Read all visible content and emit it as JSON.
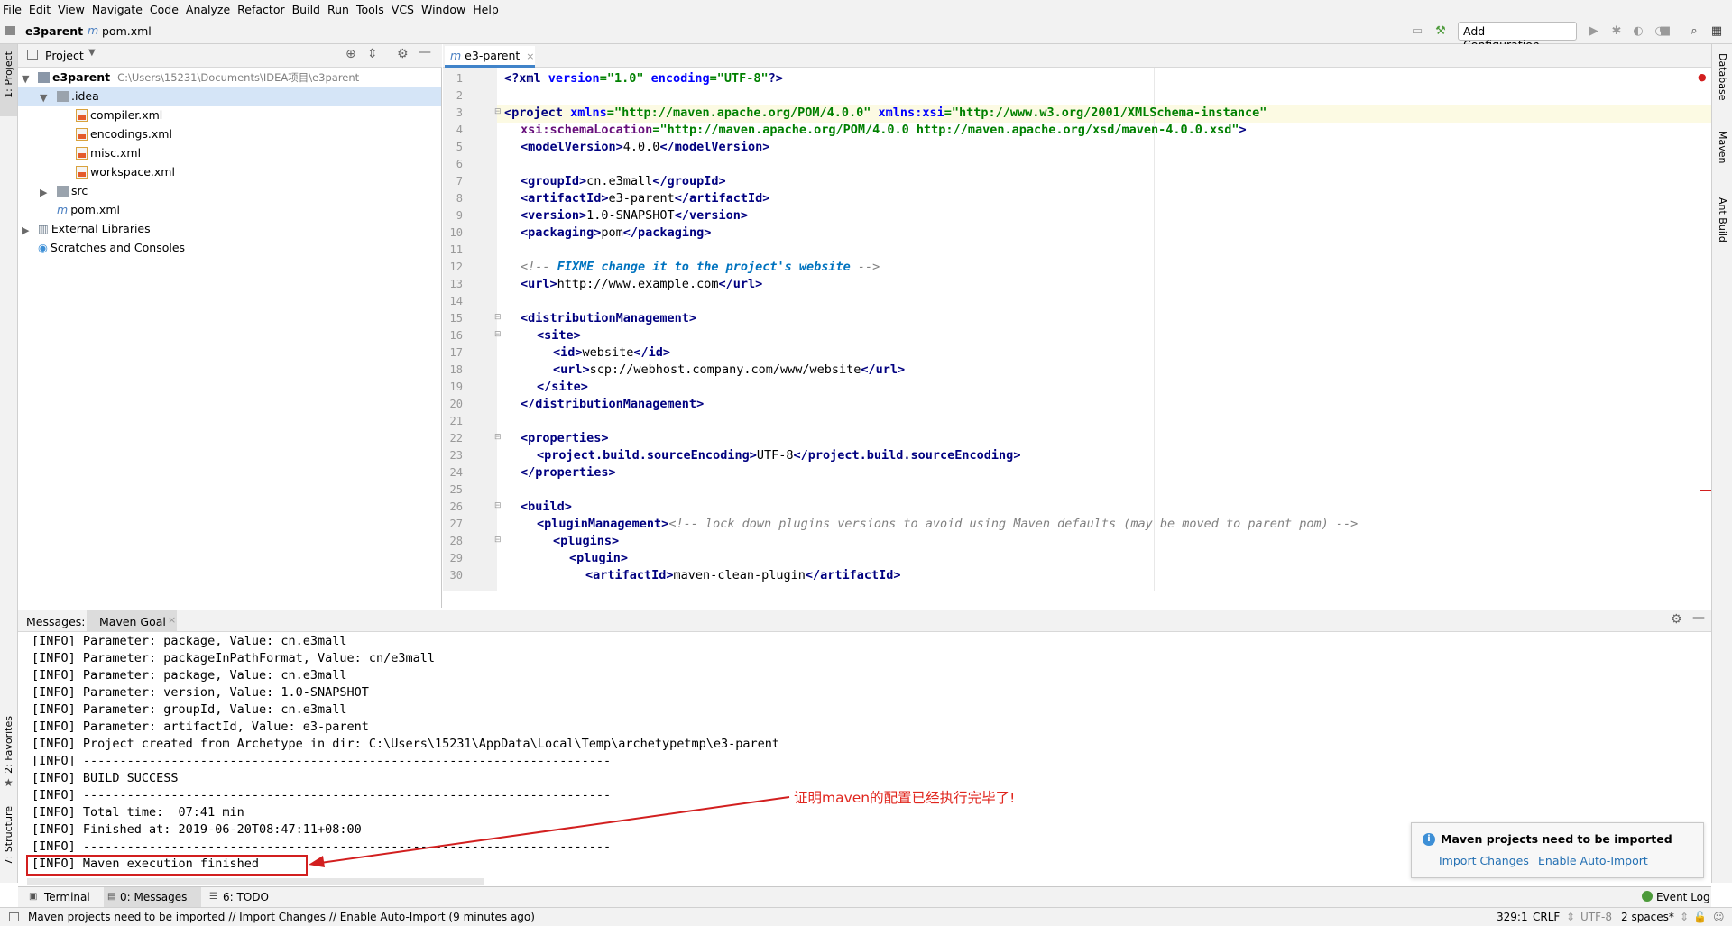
{
  "menu": [
    "File",
    "Edit",
    "View",
    "Navigate",
    "Code",
    "Analyze",
    "Refactor",
    "Build",
    "Run",
    "Tools",
    "VCS",
    "Window",
    "Help"
  ],
  "nav": {
    "project": "e3parent",
    "file": "pom.xml",
    "add_configuration": "Add Configuration..."
  },
  "left_stripe": {
    "project": "1: Project",
    "favorites": "2: Favorites",
    "structure": "7: Structure"
  },
  "right_stripe": {
    "database": "Database",
    "maven": "Maven",
    "ant": "Ant Build"
  },
  "project_panel": {
    "title": "Project",
    "root_name": "e3parent",
    "root_path": "C:\\Users\\15231\\Documents\\IDEA项目\\e3parent",
    "idea_folder": ".idea",
    "idea_files": [
      "compiler.xml",
      "encodings.xml",
      "misc.xml",
      "workspace.xml"
    ],
    "src": "src",
    "pom": "pom.xml",
    "external": "External Libraries",
    "scratches": "Scratches and Consoles"
  },
  "editor": {
    "tab": "e3-parent",
    "line_numbers": [
      "1",
      "2",
      "3",
      "4",
      "5",
      "6",
      "7",
      "8",
      "9",
      "10",
      "11",
      "12",
      "13",
      "14",
      "15",
      "16",
      "17",
      "18",
      "19",
      "20",
      "21",
      "22",
      "23",
      "24",
      "25",
      "26",
      "27",
      "28",
      "29",
      "30"
    ],
    "l1a": "<?xml ",
    "l1b": "version",
    "l1c": "=",
    "l1d": "\"1.0\"",
    "l1e": " encoding",
    "l1f": "=",
    "l1g": "\"UTF-8\"",
    "l1h": "?>",
    "l3a": "<project ",
    "l3b": "xmlns",
    "l3c": "=",
    "l3d": "\"http://maven.apache.org/POM/4.0.0\"",
    "l3e": " xmlns:xsi",
    "l3f": "=",
    "l3g": "\"http://www.w3.org/2001/XMLSchema-instance\"",
    "l4a": "xsi:schemaLocation",
    "l4b": "=",
    "l4c": "\"http://maven.apache.org/POM/4.0.0 http://maven.apache.org/xsd/maven-4.0.0.xsd\"",
    "l4d": ">",
    "l5a": "<modelVersion>",
    "l5b": "4.0.0",
    "l5c": "</modelVersion>",
    "l7a": "<groupId>",
    "l7b": "cn.e3mall",
    "l7c": "</groupId>",
    "l8a": "<artifactId>",
    "l8b": "e3-parent",
    "l8c": "</artifactId>",
    "l9a": "<version>",
    "l9b": "1.0-SNAPSHOT",
    "l9c": "</version>",
    "l10a": "<packaging>",
    "l10b": "pom",
    "l10c": "</packaging>",
    "l12a": "<!-- ",
    "l12b": "FIXME change it to the project's website",
    "l12c": " -->",
    "l13a": "<url>",
    "l13b": "http://www.example.com",
    "l13c": "</url>",
    "l15": "<distributionManagement>",
    "l16": "<site>",
    "l17a": "<id>",
    "l17b": "website",
    "l17c": "</id>",
    "l18a": "<url>",
    "l18b": "scp://webhost.company.com/www/website",
    "l18c": "</url>",
    "l19": "</site>",
    "l20": "</distributionManagement>",
    "l22": "<properties>",
    "l23a": "<project.build.sourceEncoding>",
    "l23b": "UTF-8",
    "l23c": "</project.build.sourceEncoding>",
    "l24": "</properties>",
    "l26": "<build>",
    "l27a": "<pluginManagement>",
    "l27b": "<!-- lock down plugins versions to avoid using Maven defaults (may be moved to parent pom) -->",
    "l28": "<plugins>",
    "l29": "<plugin>",
    "l30a": "<artifactId>",
    "l30b": "maven-clean-plugin",
    "l30c": "</artifactId>"
  },
  "messages": {
    "label": "Messages:",
    "tab": "Maven Goal",
    "lines": [
      "[INFO] Parameter: package, Value: cn.e3mall",
      "[INFO] Parameter: packageInPathFormat, Value: cn/e3mall",
      "[INFO] Parameter: package, Value: cn.e3mall",
      "[INFO] Parameter: version, Value: 1.0-SNAPSHOT",
      "[INFO] Parameter: groupId, Value: cn.e3mall",
      "[INFO] Parameter: artifactId, Value: e3-parent",
      "[INFO] Project created from Archetype in dir: C:\\Users\\15231\\AppData\\Local\\Temp\\archetypetmp\\e3-parent",
      "[INFO] ------------------------------------------------------------------------",
      "[INFO] BUILD SUCCESS",
      "[INFO] ------------------------------------------------------------------------",
      "[INFO] Total time:  07:41 min",
      "[INFO] Finished at: 2019-06-20T08:47:11+08:00",
      "[INFO] ------------------------------------------------------------------------",
      "[INFO] Maven execution finished"
    ],
    "annotation": "证明maven的配置已经执行完毕了!"
  },
  "balloon": {
    "title": "Maven projects need to be imported",
    "import": "Import Changes",
    "auto": "Enable Auto-Import"
  },
  "tools": {
    "terminal": "Terminal",
    "messages": "0: Messages",
    "todo": "6: TODO",
    "event_log": "Event Log"
  },
  "status": {
    "message": "Maven projects need to be imported // Import Changes // Enable Auto-Import (9 minutes ago)",
    "position": "329:1",
    "line_sep": "CRLF",
    "encoding": "UTF-8",
    "indent": "2 spaces*"
  }
}
